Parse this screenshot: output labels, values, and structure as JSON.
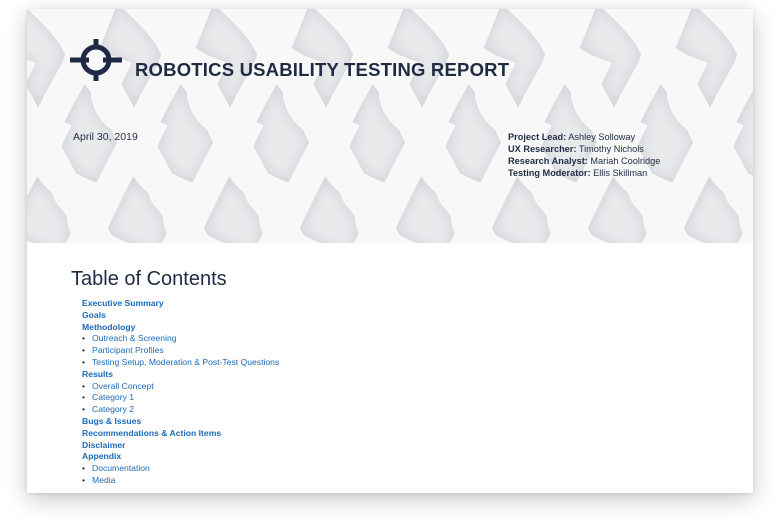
{
  "header": {
    "title": "ROBOTICS USABILITY TESTING REPORT",
    "date": "April 30, 2019",
    "logo_icon": "crosshair-circle-logo",
    "credits": [
      {
        "label": "Project Lead:",
        "value": "Ashley Solloway"
      },
      {
        "label": "UX Researcher:",
        "value": "Timothy Nichols"
      },
      {
        "label": "Research Analyst:",
        "value": "Mariah Coolridge"
      },
      {
        "label": "Testing Moderator:",
        "value": "Ellis Skillman"
      }
    ]
  },
  "toc": {
    "heading": "Table of Contents",
    "items": [
      {
        "label": "Executive Summary",
        "level": "main"
      },
      {
        "label": "Goals",
        "level": "main"
      },
      {
        "label": "Methodology",
        "level": "main"
      },
      {
        "label": "Outreach & Screening",
        "level": "sub"
      },
      {
        "label": "Participant Profiles",
        "level": "sub"
      },
      {
        "label": "Testing Setup, Moderation & Post-Test Questions",
        "level": "sub"
      },
      {
        "label": "Results",
        "level": "main"
      },
      {
        "label": "Overall Concept",
        "level": "sub"
      },
      {
        "label": "Category 1",
        "level": "sub"
      },
      {
        "label": "Category 2",
        "level": "sub"
      },
      {
        "label": "Bugs & Issues",
        "level": "main"
      },
      {
        "label": "Recommendations & Action Items",
        "level": "main"
      },
      {
        "label": "Disclaimer",
        "level": "main"
      },
      {
        "label": "Appendix",
        "level": "main"
      },
      {
        "label": "Documentation",
        "level": "sub"
      },
      {
        "label": "Media",
        "level": "sub"
      }
    ]
  },
  "colors": {
    "navy": "#1f2a44",
    "link_blue": "#1b6ab8",
    "hero_background": "#e9eaec"
  },
  "bullet_glyph": "•"
}
